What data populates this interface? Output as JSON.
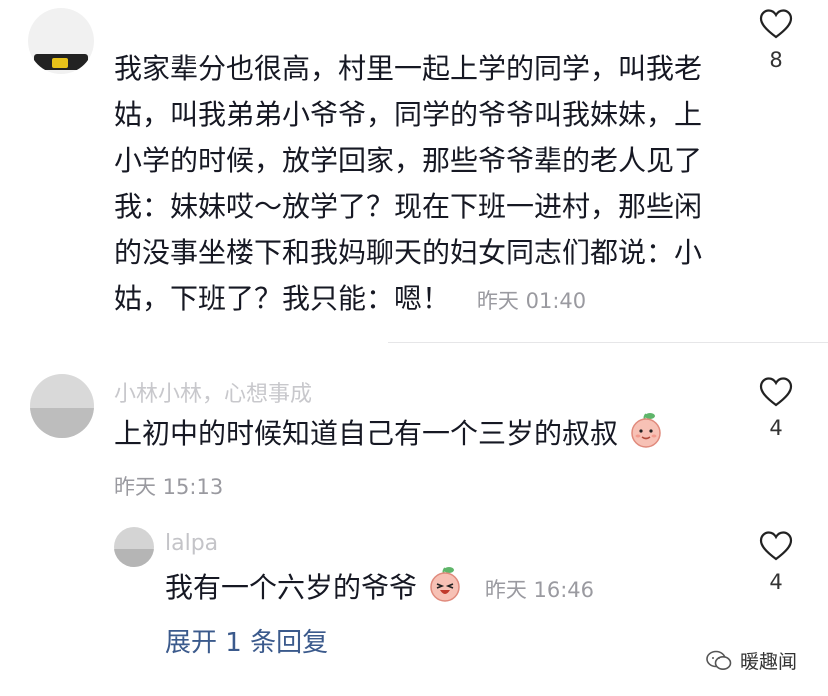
{
  "comments": [
    {
      "text": "我家辈分也很高，村里一起上学的同学，叫我老姑，叫我弟弟小爷爷，同学的爷爷叫我妹妹，上小学的时候，放学回家，那些爷爷辈的老人见了我：妹妹哎～放学了？现在下班一进村，那些闲的没事坐楼下和我妈聊天的妇女同志们都说：小姑，下班了？我只能：嗯！",
      "line1": "我家辈分也很高，村里一起上学的同学，叫我老",
      "line2": "姑，叫我弟弟小爷爷，同学的爷爷叫我妹妹，上",
      "line3": "小学的时候，放学回家，那些爷爷辈的老人见了",
      "line4": "我：妹妹哎～放学了？现在下班一进村，那些闲",
      "line5": "的没事坐楼下和我妈聊天的妇女同志们都说：小",
      "line6": "姑，下班了？我只能：嗯！",
      "time": "昨天 01:40",
      "likes": "8"
    },
    {
      "username": "小林小林，心想事成",
      "text": "上初中的时候知道自己有一个三岁的叔叔",
      "time": "昨天 15:13",
      "likes": "4",
      "emoji": "smiling-peach-emoji"
    },
    {
      "username": "lalpa",
      "text": "我有一个六岁的爷爷",
      "time": "昨天 16:46",
      "likes": "4",
      "emoji": "laughing-peach-emoji"
    }
  ],
  "expand_replies": "展开 1 条回复",
  "watermark": "暖趣闻",
  "colors": {
    "text": "#161823",
    "meta": "#9a9aa0",
    "link": "#3b5a8c",
    "peach": "#f7b3a8",
    "leaf": "#5fb56a"
  }
}
